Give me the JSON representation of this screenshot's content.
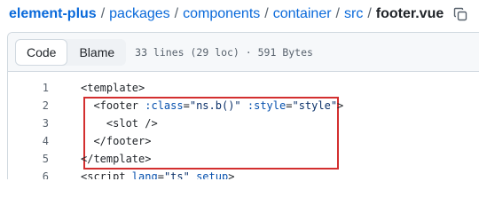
{
  "breadcrumb": {
    "repo": "element-plus",
    "parts": [
      "packages",
      "components",
      "container",
      "src"
    ],
    "file": "footer.vue",
    "separator": "/"
  },
  "toolbar": {
    "code_label": "Code",
    "blame_label": "Blame",
    "meta": "33 lines (29 loc) · 591 Bytes"
  },
  "icons": {
    "copy": "copy-icon"
  },
  "code": {
    "lines": [
      {
        "num": "1",
        "indent": "",
        "tokens": [
          {
            "t": "tag",
            "v": "<template>"
          }
        ]
      },
      {
        "num": "2",
        "indent": "  ",
        "tokens": [
          {
            "t": "tag",
            "v": "<footer "
          },
          {
            "t": "attr",
            "v": ":class"
          },
          {
            "t": "tag",
            "v": "="
          },
          {
            "t": "str",
            "v": "\"ns.b()\""
          },
          {
            "t": "tag",
            "v": " "
          },
          {
            "t": "attr",
            "v": ":style"
          },
          {
            "t": "tag",
            "v": "="
          },
          {
            "t": "str",
            "v": "\"style\""
          },
          {
            "t": "tag",
            "v": ">"
          }
        ]
      },
      {
        "num": "3",
        "indent": "    ",
        "tokens": [
          {
            "t": "tag",
            "v": "<slot />"
          }
        ]
      },
      {
        "num": "4",
        "indent": "  ",
        "tokens": [
          {
            "t": "tag",
            "v": "</footer>"
          }
        ]
      },
      {
        "num": "5",
        "indent": "",
        "tokens": [
          {
            "t": "tag",
            "v": "</template>"
          }
        ]
      },
      {
        "num": "6",
        "indent": "",
        "tokens": [
          {
            "t": "tag",
            "v": "<script "
          },
          {
            "t": "attr",
            "v": "lang"
          },
          {
            "t": "tag",
            "v": "="
          },
          {
            "t": "str",
            "v": "\"ts\""
          },
          {
            "t": "tag",
            "v": " "
          },
          {
            "t": "attr",
            "v": "setup"
          },
          {
            "t": "tag",
            "v": ">"
          }
        ]
      }
    ]
  },
  "colors": {
    "link": "#0969da",
    "highlight_border": "#d32f2f",
    "attr": "#0550ae",
    "string": "#0a3069"
  }
}
